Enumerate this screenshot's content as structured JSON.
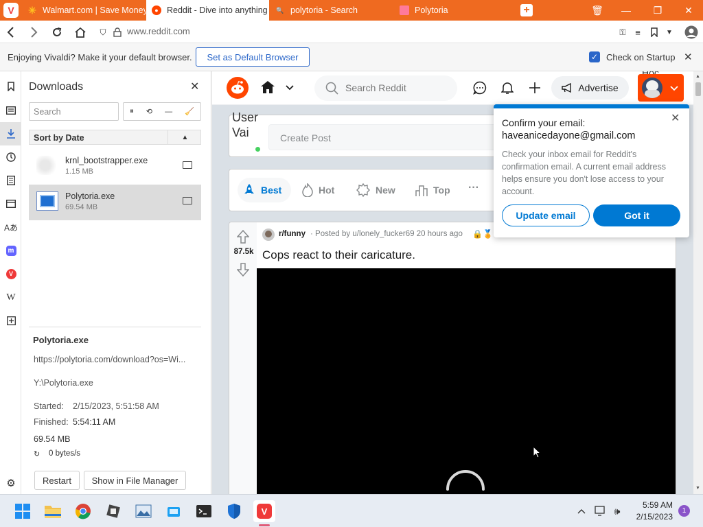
{
  "tabs": [
    {
      "label": "Walmart.com | Save Money"
    },
    {
      "label": "Reddit - Dive into anything"
    },
    {
      "label": "polytoria - Search"
    },
    {
      "label": "Polytoria"
    }
  ],
  "address": {
    "url": "www.reddit.com"
  },
  "notification": {
    "message": "Enjoying Vivaldi? Make it your default browser.",
    "button": "Set as Default Browser",
    "checkbox_label": "Check on Startup"
  },
  "downloads": {
    "title": "Downloads",
    "search_placeholder": "Search",
    "sort_label": "Sort by Date",
    "items": [
      {
        "name": "krnl_bootstrapper.exe",
        "size": "1.15 MB"
      },
      {
        "name": "Polytoria.exe",
        "size": "69.54 MB"
      }
    ],
    "details": {
      "name": "Polytoria.exe",
      "url": "https://polytoria.com/download?os=Wi...",
      "path": "Y:\\Polytoria.exe",
      "started_label": "Started:",
      "started": "2/15/2023, 5:51:58 AM",
      "finished_label": "Finished:",
      "finished": "5:54:11 AM",
      "size": "69.54 MB",
      "speed": "0 bytes/s"
    },
    "restart": "Restart",
    "show_in_manager": "Show in File Manager"
  },
  "reddit": {
    "search_placeholder": "Search Reddit",
    "advertise": "Advertise",
    "user_cut_text": "Hoc",
    "avatar_alt": "User Vai",
    "create_post": "Create Post",
    "sort": [
      "Best",
      "Hot",
      "New",
      "Top"
    ],
    "more": "···",
    "post": {
      "subreddit": "r/funny",
      "posted_by": "· Posted by u/lonely_fucker69 20 hours ago",
      "votes": "87.5k",
      "title": "Cops react to their caricature."
    }
  },
  "popup": {
    "title_line1": "Confirm your email:",
    "title_line2": "haveanicedayone@gmail.com",
    "body": "Check your inbox email for Reddit's confirmation email. A current email address helps ensure you don't lose access to your account.",
    "update": "Update email",
    "gotit": "Got it"
  },
  "taskbar": {
    "time": "5:59 AM",
    "date": "2/15/2023",
    "notif_count": "1"
  },
  "colors": {
    "vivaldi_orange": "#ef6a20",
    "reddit_orange": "#ff4500",
    "reddit_blue": "#0079d3",
    "reddit_bg": "#dae0e6"
  }
}
